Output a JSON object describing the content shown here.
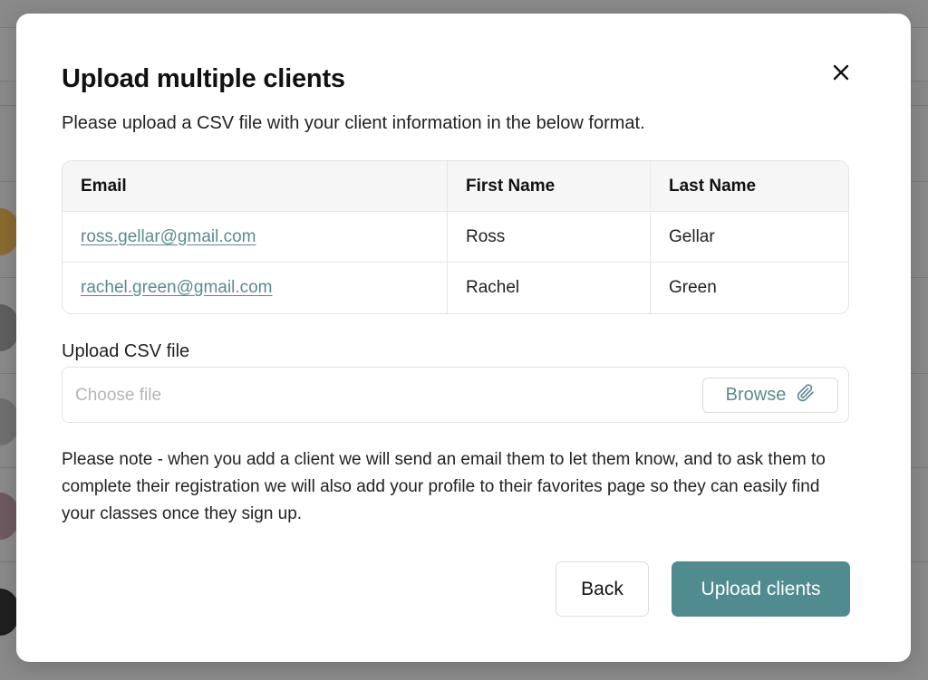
{
  "modal": {
    "title": "Upload multiple clients",
    "subtitle": "Please upload a CSV file with your client information in the below format.",
    "close_icon": "close-icon"
  },
  "example_table": {
    "headers": [
      "Email",
      "First Name",
      "Last Name"
    ],
    "rows": [
      [
        "ross.gellar@gmail.com",
        "Ross",
        "Gellar"
      ],
      [
        "rachel.green@gmail.com",
        "Rachel",
        "Green"
      ]
    ]
  },
  "upload": {
    "label": "Upload CSV file",
    "placeholder": "Choose file",
    "browse_label": "Browse",
    "browse_icon": "paperclip-icon"
  },
  "note": "Please note - when you add a client we will send an email them to let them know, and to ask them to complete their registration we will also add your profile to their favorites page so they can easily find your classes once they sign up.",
  "footer": {
    "back_label": "Back",
    "upload_label": "Upload clients"
  },
  "colors": {
    "accent": "#4f8b8f",
    "link": "#5b8a8f",
    "overlay": "#8a8a8a"
  }
}
